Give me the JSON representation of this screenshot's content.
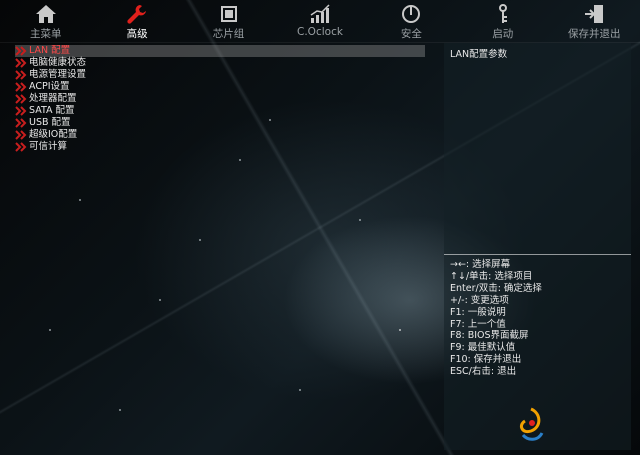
{
  "tabs": [
    {
      "label": "主菜单",
      "icon": "home-icon",
      "active": false
    },
    {
      "label": "高级",
      "icon": "wrench-icon",
      "active": true
    },
    {
      "label": "芯片组",
      "icon": "chip-icon",
      "active": false
    },
    {
      "label": "C.Oclock",
      "icon": "performance-chart-icon",
      "active": false
    },
    {
      "label": "安全",
      "icon": "power-lock-icon",
      "active": false
    },
    {
      "label": "启动",
      "icon": "boot-key-icon",
      "active": false
    },
    {
      "label": "保存并退出",
      "icon": "exit-door-icon",
      "active": false
    }
  ],
  "menu": {
    "items": [
      {
        "label": "LAN 配置",
        "selected": true
      },
      {
        "label": "电脑健康状态",
        "selected": false
      },
      {
        "label": "电源管理设置",
        "selected": false
      },
      {
        "label": "ACPI设置",
        "selected": false
      },
      {
        "label": "处理器配置",
        "selected": false
      },
      {
        "label": "SATA 配置",
        "selected": false
      },
      {
        "label": "USB 配置",
        "selected": false
      },
      {
        "label": "超级IO配置",
        "selected": false
      },
      {
        "label": "可信计算",
        "selected": false
      }
    ]
  },
  "right_panel": {
    "title": "LAN配置参数",
    "help": [
      "→←: 选择屏幕",
      "↑↓/单击: 选择项目",
      "Enter/双击: 确定选择",
      "+/-: 变更选项",
      "F1: 一般说明",
      "F7: 上一个值",
      "F8: BIOS界面截屏",
      "F9: 最佳默认值",
      "F10: 保存并退出",
      "ESC/右击: 退出"
    ]
  },
  "colors": {
    "active_tab_icon": "#e0201c",
    "selected_item_text": "#ff4a4a",
    "arrow": "#c81e1e"
  }
}
